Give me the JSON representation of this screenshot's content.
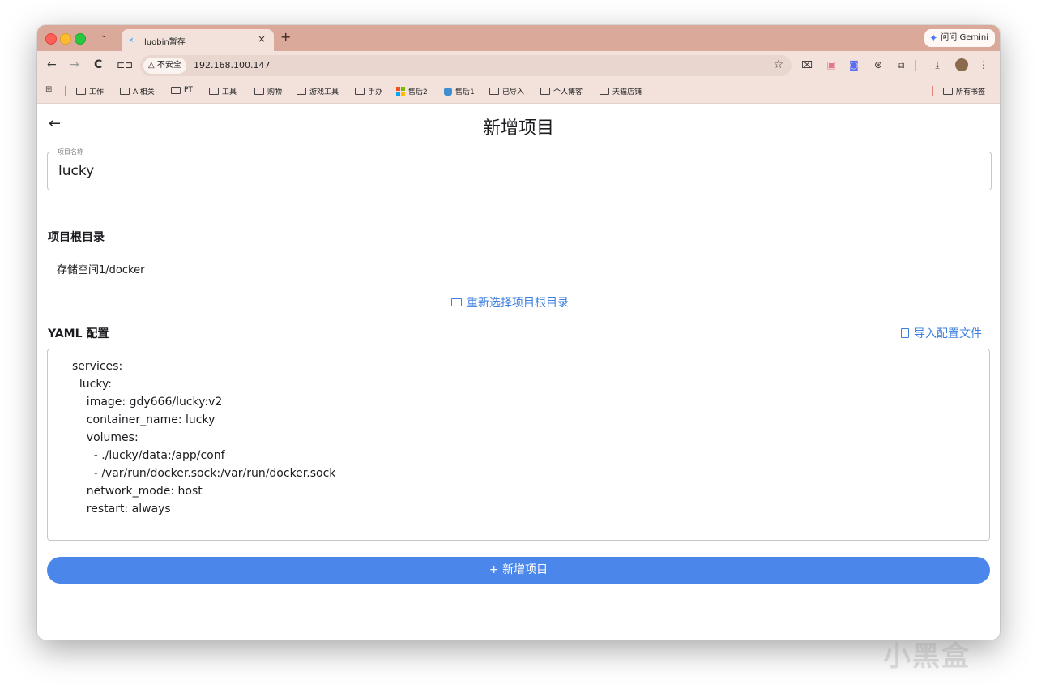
{
  "browser": {
    "tab": {
      "title": "luobin暂存",
      "close_glyph": "×"
    },
    "new_tab_glyph": "+",
    "tab_dropdown_glyph": "⌄",
    "gemini_label": "问问 Gemini",
    "security_label": "△ 不安全",
    "url": "192.168.100.147",
    "nav": {
      "back": "←",
      "forward": "→",
      "reload": "C",
      "split": "⊏⊐"
    },
    "icons": {
      "star": "☆",
      "menu": "⋮",
      "download": "⤓"
    },
    "bookmarks": {
      "apps_glyph": "⊞",
      "items": [
        "工作",
        "AI相关",
        "PT",
        "工具",
        "购物",
        "游戏工具",
        "手办",
        "售后2",
        "售后1",
        "已导入",
        "个人博客",
        "天猫店铺"
      ],
      "all_bookmarks": "所有书签"
    }
  },
  "page": {
    "back_glyph": "←",
    "title": "新增项目",
    "name_field": {
      "label": "项目名称",
      "value": "lucky"
    },
    "root_dir": {
      "heading": "项目根目录",
      "value": "存储空间1/docker",
      "reselect_label": "重新选择项目根目录"
    },
    "yaml": {
      "heading": "YAML 配置",
      "import_label": "导入配置文件",
      "lines": [
        "services:",
        "  lucky:",
        "    image: gdy666/lucky:v2",
        "    container_name: lucky",
        "    volumes:",
        "      - ./lucky/data:/app/conf",
        "      - /var/run/docker.sock:/var/run/docker.sock",
        "    network_mode: host",
        "    restart: always"
      ]
    },
    "submit_label": "+ 新增项目"
  },
  "watermark": "小黑盒",
  "colors": {
    "accent": "#4b86ea",
    "link": "#3d7fe0",
    "titlebar": "#dba99a",
    "toolbar": "#f3e2dc"
  }
}
